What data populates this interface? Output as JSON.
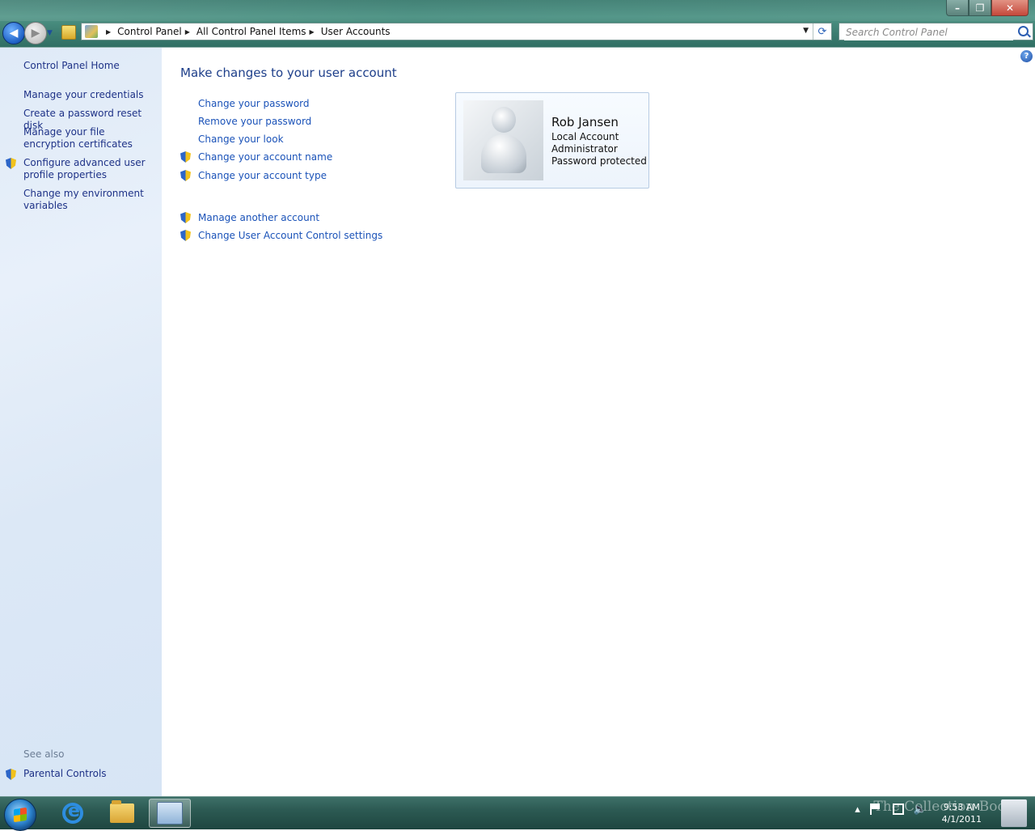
{
  "window": {
    "minimize_label": "–",
    "maximize_label": "❐",
    "close_label": "✕"
  },
  "nav": {
    "back_glyph": "◀",
    "forward_glyph": "▶",
    "breadcrumbs": [
      "Control Panel",
      "All Control Panel Items",
      "User Accounts"
    ],
    "search_placeholder": "Search Control Panel"
  },
  "sidebar": {
    "items": [
      {
        "label": "Control Panel Home"
      },
      {
        "label": "Manage your credentials"
      },
      {
        "label": "Create a password reset disk"
      },
      {
        "label": "Manage your file encryption certificates"
      },
      {
        "label": "Configure advanced user profile properties"
      },
      {
        "label": "Change my environment variables"
      }
    ],
    "see_also_label": "See also",
    "see_also_items": [
      {
        "label": "Parental Controls"
      }
    ]
  },
  "main": {
    "title": "Make changes to your user account",
    "help_glyph": "?",
    "tasks": [
      {
        "label": "Change your password"
      },
      {
        "label": "Remove your password"
      },
      {
        "label": "Change your look"
      },
      {
        "label": "Change your account name"
      },
      {
        "label": "Change your account type"
      }
    ],
    "other_tasks": [
      {
        "label": "Manage another account"
      },
      {
        "label": "Change User Account Control settings"
      }
    ]
  },
  "user": {
    "name": "Rob Jansen",
    "account_type": "Local Account",
    "role": "Administrator",
    "password_status": "Password protected"
  },
  "taskbar": {
    "time": "9:53 AM",
    "date": "4/1/2011",
    "watermark": "The Collection Book"
  },
  "colors": {
    "link": "#1a52b8",
    "title": "#1e3f8a",
    "sidebar_link": "#1e3287"
  }
}
